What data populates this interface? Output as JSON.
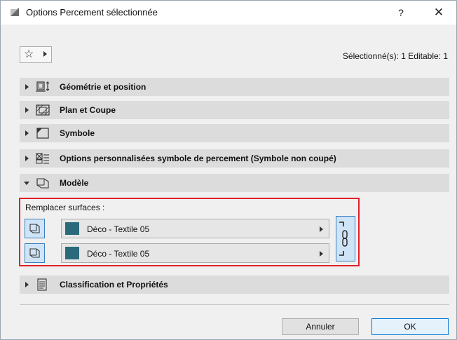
{
  "window": {
    "title": "Options Percement sélectionnée",
    "help_label": "?",
    "close_label": "✕"
  },
  "toolbar": {
    "favorites_icon": "star-icon",
    "selection_info": "Sélectionné(s): 1 Editable: 1"
  },
  "sections": [
    {
      "label": "Géométrie et position",
      "icon": "geometry-position-icon",
      "expanded": false
    },
    {
      "label": "Plan et Coupe",
      "icon": "floor-plan-section-icon",
      "expanded": false
    },
    {
      "label": "Symbole",
      "icon": "symbol-icon",
      "expanded": false
    },
    {
      "label": "Options personnalisées symbole de percement (Symbole non coupé)",
      "icon": "custom-settings-icon",
      "expanded": false
    },
    {
      "label": "Modèle",
      "icon": "model-icon",
      "expanded": true
    },
    {
      "label": "Classification et Propriétés",
      "icon": "classification-icon",
      "expanded": false
    }
  ],
  "model": {
    "override_label": "Remplacer surfaces :",
    "surfaces": [
      {
        "name": "Déco - Textile 05",
        "color": "#2b6a7a",
        "icon": "surface-icon"
      },
      {
        "name": "Déco - Textile 05",
        "color": "#2b6a7a",
        "icon": "surface-icon"
      }
    ],
    "link_icon": "chain-link-icon",
    "highlight_color": "#e0202a"
  },
  "footer": {
    "cancel_label": "Annuler",
    "ok_label": "OK"
  }
}
